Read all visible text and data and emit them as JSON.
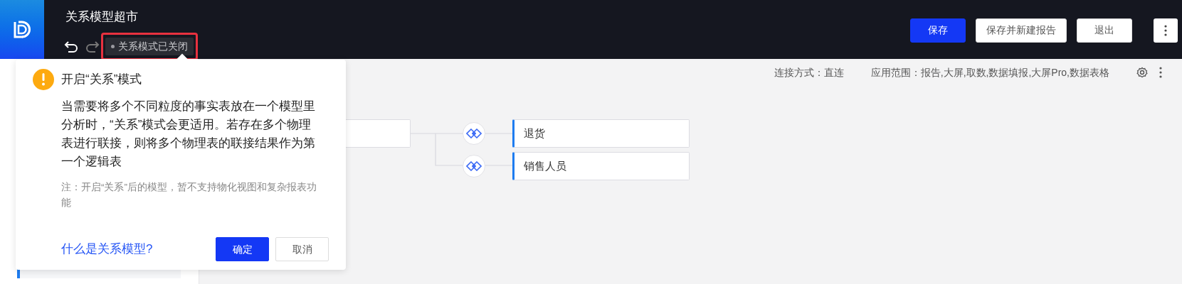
{
  "app": {
    "title": "关系模型超市",
    "relation_status": "关系模式已关闭",
    "redo_disabled": true,
    "status_highlighted": true
  },
  "header_buttons": [
    {
      "label": "保存",
      "kind": "primary"
    },
    {
      "label": "保存并新建报告",
      "kind": "default"
    },
    {
      "label": "退出",
      "kind": "default"
    }
  ],
  "info": {
    "connection": "连接方式：直连",
    "scope": "应用范围：报告,大屏,取数,数据填报,大屏Pro,数据表格"
  },
  "diagram": {
    "tables": [
      {
        "name": "退货"
      },
      {
        "name": "销售人员"
      }
    ]
  },
  "popover": {
    "title": "开启“关系”模式",
    "body": "当需要将多个不同粒度的事实表放在一个模型里分析时，“关系”模式会更适用。若存在多个物理表进行联接，则将多个物理表的联接结果作为第一个逻辑表",
    "note": "注：开启“关系”后的模型，暂不支持物化视图和复杂报表功能",
    "link": "什么是关系模型?",
    "buttons": [
      {
        "label": "确定",
        "kind": "primary"
      },
      {
        "label": "取消",
        "kind": "default"
      }
    ]
  }
}
